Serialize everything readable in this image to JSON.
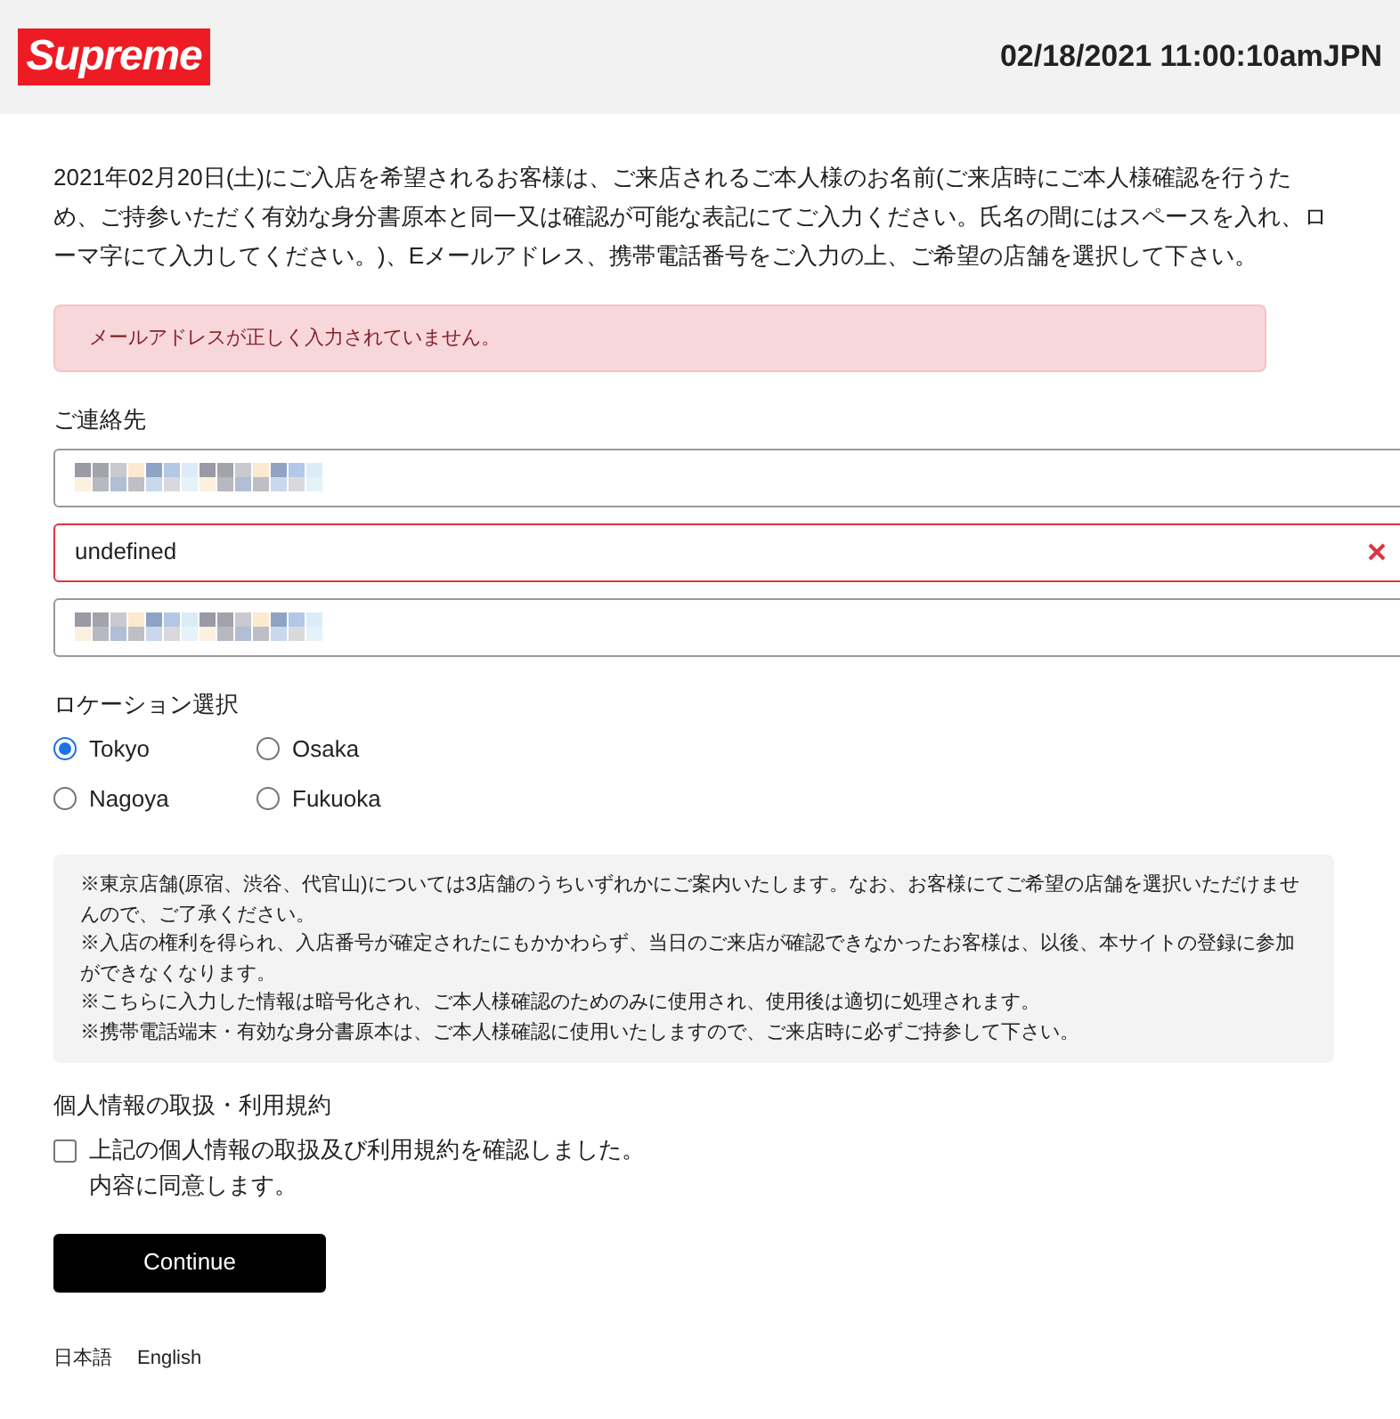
{
  "header": {
    "logo": "Supreme",
    "datetime": "02/18/2021 11:00:10amJPN"
  },
  "intro": "2021年02月20日(土)にご入店を希望されるお客様は、ご来店されるご本人様のお名前(ご来店時にご本人様確認を行うため、ご持参いただく有効な身分書原本と同一又は確認が可能な表記にてご入力ください。氏名の間にはスペースを入れ、ローマ字にて入力してください。)、Eメールアドレス、携帯電話番号をご入力の上、ご希望の店舗を選択して下さい。",
  "alert": "メールアドレスが正しく入力されていません。",
  "contact": {
    "label": "ご連絡先",
    "fields": [
      {
        "kind": "redacted",
        "invalid": false
      },
      {
        "kind": "text",
        "value": "undefined",
        "invalid": true
      },
      {
        "kind": "redacted",
        "invalid": false
      }
    ]
  },
  "location": {
    "label": "ロケーション選択",
    "options": [
      {
        "label": "Tokyo",
        "selected": true
      },
      {
        "label": "Osaka",
        "selected": false
      },
      {
        "label": "Nagoya",
        "selected": false
      },
      {
        "label": "Fukuoka",
        "selected": false
      }
    ]
  },
  "notes": [
    "※東京店舗(原宿、渋谷、代官山)については3店舗のうちいずれかにご案内いたします。なお、お客様にてご希望の店舗を選択いただけませんので、ご了承ください。",
    "※入店の権利を得られ、入店番号が確定されたにもかかわらず、当日のご来店が確認できなかったお客様は、以後、本サイトの登録に参加ができなくなります。",
    "※こちらに入力した情報は暗号化され、ご本人様確認のためのみに使用され、使用後は適切に処理されます。",
    "※携帯電話端末・有効な身分書原本は、ご本人様確認に使用いたしますので、ご来店時に必ずご持参して下さい。"
  ],
  "terms": {
    "label": "個人情報の取扱・利用規約",
    "checkbox": {
      "checked": false,
      "lines": [
        "上記の個人情報の取扱及び利用規約を確認しました。",
        "内容に同意します。"
      ]
    }
  },
  "button": "Continue",
  "languages": [
    "日本語",
    "English"
  ]
}
